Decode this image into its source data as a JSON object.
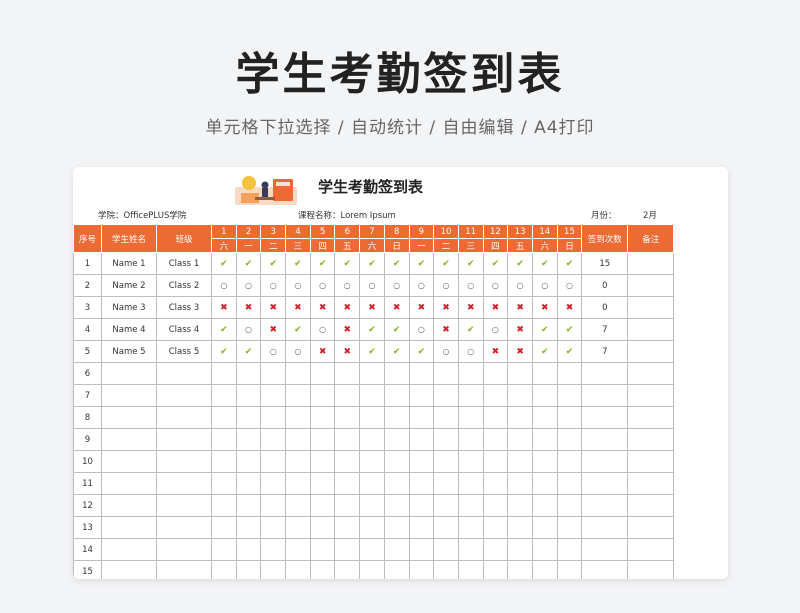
{
  "hero": {
    "title": "学生考勤签到表",
    "subtitle": "单元格下拉选择 / 自动统计 / 自由编辑 / A4打印"
  },
  "sheet": {
    "title": "学生考勤签到表",
    "college_label": "学院：OfficePLUS学院",
    "course_label": "课程名称：Lorem Ipsum",
    "month_label": "月份：",
    "month_value": "2月",
    "headers": {
      "seq": "序号",
      "name": "学生姓名",
      "class": "班级",
      "count": "签到次数",
      "note": "备注"
    },
    "days": [
      "1",
      "2",
      "3",
      "4",
      "5",
      "6",
      "7",
      "8",
      "9",
      "10",
      "11",
      "12",
      "13",
      "14",
      "15"
    ],
    "weekdays": [
      "六",
      "一",
      "二",
      "三",
      "四",
      "五",
      "六",
      "日",
      "一",
      "二",
      "三",
      "四",
      "五",
      "六",
      "日"
    ],
    "rows": [
      {
        "seq": "1",
        "name": "Name 1",
        "class": "Class 1",
        "marks": [
          "check",
          "check",
          "check",
          "check",
          "check",
          "check",
          "check",
          "check",
          "check",
          "check",
          "check",
          "check",
          "check",
          "check",
          "check"
        ],
        "count": "15",
        "note": ""
      },
      {
        "seq": "2",
        "name": "Name 2",
        "class": "Class 2",
        "marks": [
          "dot",
          "dot",
          "dot",
          "dot",
          "dot",
          "dot",
          "dot",
          "dot",
          "dot",
          "dot",
          "dot",
          "dot",
          "dot",
          "dot",
          "dot"
        ],
        "count": "0",
        "note": ""
      },
      {
        "seq": "3",
        "name": "Name 3",
        "class": "Class 3",
        "marks": [
          "cross",
          "cross",
          "cross",
          "cross",
          "cross",
          "cross",
          "cross",
          "cross",
          "cross",
          "cross",
          "cross",
          "cross",
          "cross",
          "cross",
          "cross"
        ],
        "count": "0",
        "note": ""
      },
      {
        "seq": "4",
        "name": "Name 4",
        "class": "Class 4",
        "marks": [
          "check",
          "dot",
          "cross",
          "check",
          "dot",
          "cross",
          "check",
          "check",
          "dot",
          "cross",
          "check",
          "dot",
          "cross",
          "check",
          "check"
        ],
        "count": "7",
        "note": ""
      },
      {
        "seq": "5",
        "name": "Name 5",
        "class": "Class 5",
        "marks": [
          "check",
          "check",
          "dot",
          "dot",
          "cross",
          "cross",
          "check",
          "check",
          "check",
          "dot",
          "dot",
          "cross",
          "cross",
          "check",
          "check"
        ],
        "count": "7",
        "note": ""
      },
      {
        "seq": "6",
        "name": "",
        "class": "",
        "marks": [],
        "count": "",
        "note": ""
      },
      {
        "seq": "7",
        "name": "",
        "class": "",
        "marks": [],
        "count": "",
        "note": ""
      },
      {
        "seq": "8",
        "name": "",
        "class": "",
        "marks": [],
        "count": "",
        "note": ""
      },
      {
        "seq": "9",
        "name": "",
        "class": "",
        "marks": [],
        "count": "",
        "note": ""
      },
      {
        "seq": "10",
        "name": "",
        "class": "",
        "marks": [],
        "count": "",
        "note": ""
      },
      {
        "seq": "11",
        "name": "",
        "class": "",
        "marks": [],
        "count": "",
        "note": ""
      },
      {
        "seq": "12",
        "name": "",
        "class": "",
        "marks": [],
        "count": "",
        "note": ""
      },
      {
        "seq": "13",
        "name": "",
        "class": "",
        "marks": [],
        "count": "",
        "note": ""
      },
      {
        "seq": "14",
        "name": "",
        "class": "",
        "marks": [],
        "count": "",
        "note": ""
      },
      {
        "seq": "15",
        "name": "",
        "class": "",
        "marks": [],
        "count": "",
        "note": ""
      }
    ]
  },
  "marks": {
    "check": "✔",
    "cross": "✖",
    "dot": "○"
  },
  "colors": {
    "header": "#ee6a35",
    "check": "#7cb518",
    "cross": "#d0202a"
  }
}
